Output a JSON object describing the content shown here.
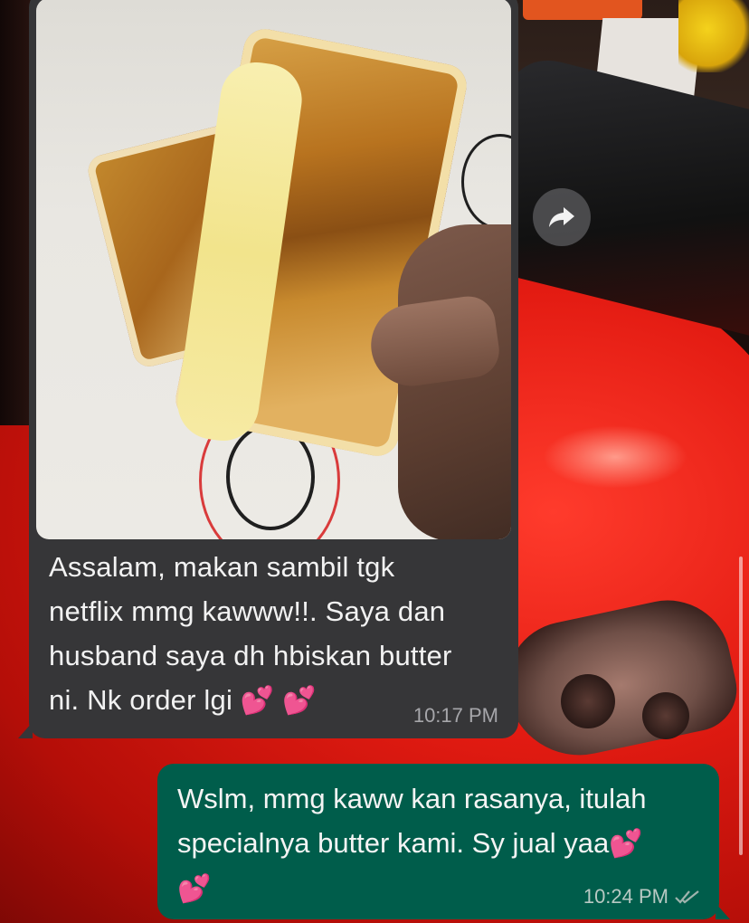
{
  "incoming_message": {
    "photo_alt": "grilled cheese toast",
    "text": "Assalam, makan sambil tgk\nnetflix mmg kawww!!. Saya dan\nhusband saya dh hbiskan butter\nni. Nk order lgi",
    "emoji": "💕 💕",
    "time": "10:17 PM"
  },
  "outgoing_message": {
    "text": "Wslm, mmg kaww kan rasanya, itulah specialnya butter kami. Sy jual yaa",
    "emoji_1": "💕",
    "emoji_2": "💕",
    "time": "10:24 PM",
    "status": "read"
  },
  "colors": {
    "incoming_bubble": "#363638",
    "outgoing_bubble": "#005d4b",
    "read_ticks": "#9fb3ad",
    "heart": "#ff4fa8"
  },
  "icons": {
    "forward": "forward-arrow-icon",
    "ticks": "double-check-icon"
  }
}
